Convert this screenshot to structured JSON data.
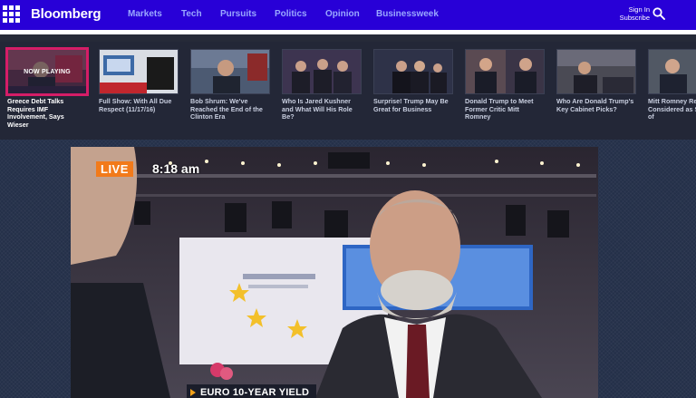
{
  "header": {
    "logo": "Bloomberg",
    "nav": [
      "Markets",
      "Tech",
      "Pursuits",
      "Politics",
      "Opinion",
      "Businessweek"
    ],
    "sign_in": "Sign In",
    "subscribe": "Subscribe"
  },
  "videos": [
    {
      "title": "Greece Debt Talks Requires IMF Involvement, Says Wieser",
      "overlay": "NOW PLAYING",
      "active": true
    },
    {
      "title": "Full Show: With All Due Respect (11/17/16)"
    },
    {
      "title": "Bob Shrum: We've Reached the End of the Clinton Era"
    },
    {
      "title": "Who Is Jared Kushner and What Will His Role Be?"
    },
    {
      "title": "Surprise! Trump May Be Great for Business"
    },
    {
      "title": "Donald Trump to Meet Former Critic Mitt Romney"
    },
    {
      "title": "Who Are Donald Trump's Key Cabinet Picks?"
    },
    {
      "title": "Mitt Romney Reportedly Considered as Secretary of"
    }
  ],
  "player": {
    "live_label": "LIVE",
    "time": "8:18 am",
    "lower_third": "EURO 10-YEAR YIELD"
  },
  "colors": {
    "brand": "#2800d7",
    "live": "#f27a1a",
    "active_outline": "#d51d67"
  }
}
